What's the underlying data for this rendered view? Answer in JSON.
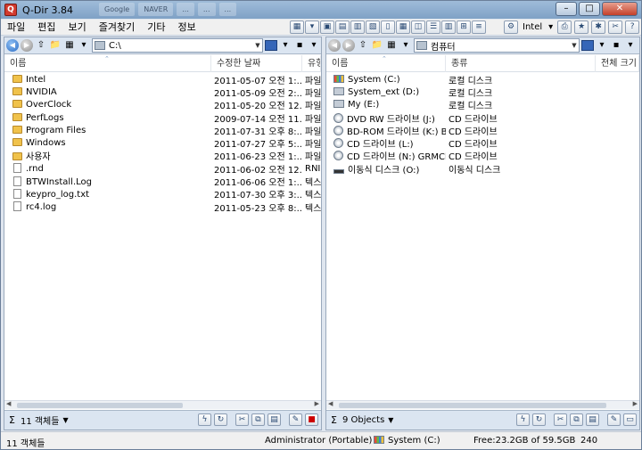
{
  "window": {
    "title": "Q-Dir 3.84",
    "background_tabs": [
      "...",
      "Google",
      "NAVER",
      "...",
      "...",
      "...",
      "...",
      "..."
    ]
  },
  "menu": [
    "파일",
    "편집",
    "보기",
    "즐겨찾기",
    "기타",
    "정보"
  ],
  "toolbar_right": {
    "user_label": "Intel"
  },
  "left_pane": {
    "address": "C:\\",
    "columns": [
      "이름",
      "수정한 날짜",
      "유형"
    ],
    "items": [
      {
        "name": "Intel",
        "date": "2011-05-07 오전 1:...",
        "type": "파일",
        "kind": "folder"
      },
      {
        "name": "NVIDIA",
        "date": "2011-05-09 오전 2:...",
        "type": "파일",
        "kind": "folder"
      },
      {
        "name": "OverClock",
        "date": "2011-05-20 오전 12...",
        "type": "파일",
        "kind": "folder"
      },
      {
        "name": "PerfLogs",
        "date": "2009-07-14 오전 11...",
        "type": "파일",
        "kind": "folder"
      },
      {
        "name": "Program Files",
        "date": "2011-07-31 오후 8:...",
        "type": "파일",
        "kind": "folder"
      },
      {
        "name": "Windows",
        "date": "2011-07-27 오후 5:...",
        "type": "파일",
        "kind": "folder"
      },
      {
        "name": "사용자",
        "date": "2011-06-23 오전 1:...",
        "type": "파일",
        "kind": "folder"
      },
      {
        "name": ".rnd",
        "date": "2011-06-02 오전 12...",
        "type": "RNI",
        "kind": "file"
      },
      {
        "name": "BTWInstall.Log",
        "date": "2011-06-06 오전 1:...",
        "type": "텍스",
        "kind": "file"
      },
      {
        "name": "keypro_log.txt",
        "date": "2011-07-30 오후 3:...",
        "type": "텍스",
        "kind": "file"
      },
      {
        "name": "rc4.log",
        "date": "2011-05-23 오후 8:...",
        "type": "텍스",
        "kind": "file"
      }
    ],
    "status_count": "11 객체들"
  },
  "right_pane": {
    "address": "컴퓨터",
    "columns": [
      "이름",
      "종류",
      "전체 크기"
    ],
    "items": [
      {
        "name": "System (C:)",
        "type": "로컬 디스크",
        "kind": "sys"
      },
      {
        "name": "System_ext (D:)",
        "type": "로컬 디스크",
        "kind": "hdd"
      },
      {
        "name": "My (E:)",
        "type": "로컬 디스크",
        "kind": "hdd"
      },
      {
        "name": "DVD RW 드라이브 (J:)",
        "type": "CD 드라이브",
        "kind": "cd"
      },
      {
        "name": "BD-ROM 드라이브 (K:) BR...",
        "type": "CD 드라이브",
        "kind": "cd"
      },
      {
        "name": "CD 드라이브 (L:)",
        "type": "CD 드라이브",
        "kind": "cd"
      },
      {
        "name": "CD 드라이브 (N:) GRMCk...",
        "type": "CD 드라이브",
        "kind": "cd"
      },
      {
        "name": "이동식 디스크 (O:)",
        "type": "이동식 디스크",
        "kind": "usb"
      }
    ],
    "status_count": "9 Objects"
  },
  "statusbar": {
    "count": "11 객체들",
    "user": "Administrator (Portable)",
    "drive": "System (C:)",
    "free": "Free:23.2GB of 59.5GB",
    "number": "240"
  },
  "colors": {
    "pane_header": "#dbe5f1",
    "folder": "#f0c24b",
    "titlebar": "#9fbcd9"
  }
}
